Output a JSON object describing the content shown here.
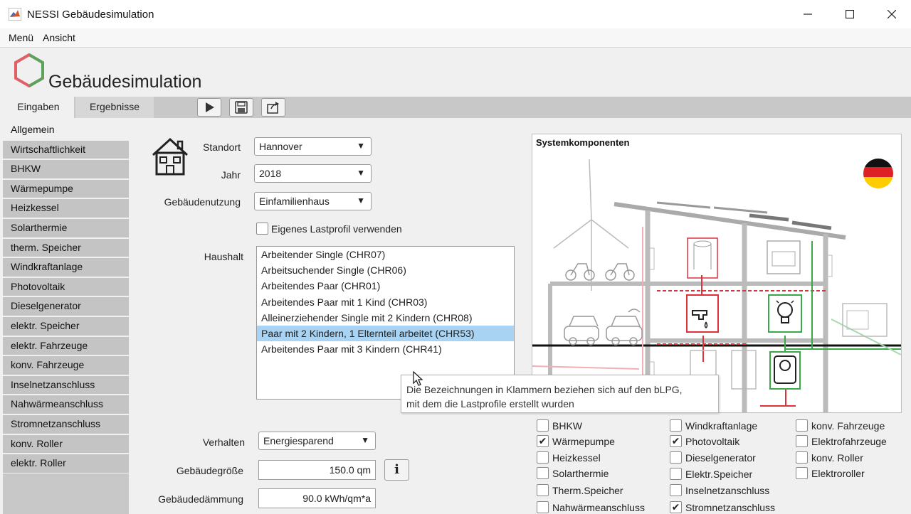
{
  "window": {
    "title": "NESSI Gebäudesimulation"
  },
  "menu": {
    "items": [
      "Menü",
      "Ansicht"
    ]
  },
  "header": {
    "title": "Gebäudesimulation"
  },
  "tabs": [
    {
      "label": "Eingaben",
      "active": true
    },
    {
      "label": "Ergebnisse",
      "active": false
    }
  ],
  "toolbar": {
    "icons": [
      "play-icon",
      "save-icon",
      "export-icon"
    ]
  },
  "sidebar": {
    "items": [
      "Allgemein",
      "Wirtschaftlichkeit",
      "BHKW",
      "Wärmepumpe",
      "Heizkessel",
      "Solarthermie",
      "therm. Speicher",
      "Windkraftanlage",
      "Photovoltaik",
      "Dieselgenerator",
      "elektr. Speicher",
      "elektr. Fahrzeuge",
      "konv. Fahrzeuge",
      "Inselnetzanschluss",
      "Nahwärmeanschluss",
      "Stromnetzanschluss",
      "konv. Roller",
      "elektr. Roller"
    ],
    "active_index": 0
  },
  "form": {
    "standort": {
      "label": "Standort",
      "value": "Hannover"
    },
    "jahr": {
      "label": "Jahr",
      "value": "2018"
    },
    "nutzung": {
      "label": "Gebäudenutzung",
      "value": "Einfamilienhaus"
    },
    "eigenes_lastprofil": {
      "label": "Eigenes Lastprofil verwenden",
      "checked": false
    },
    "haushalt": {
      "label": "Haushalt",
      "options": [
        "Arbeitender Single (CHR07)",
        "Arbeitsuchender Single (CHR06)",
        "Arbeitendes Paar (CHR01)",
        "Arbeitendes Paar mit 1 Kind (CHR03)",
        "Alleinerziehender Single mit 2 Kindern (CHR08)",
        "Paar mit 2 Kindern, 1 Elternteil arbeitet (CHR53)",
        "Arbeitendes Paar mit 3 Kindern (CHR41)"
      ],
      "selected_index": 5
    },
    "verhalten": {
      "label": "Verhalten",
      "value": "Energiesparend"
    },
    "groesse": {
      "label": "Gebäudegröße",
      "value": "150.0 qm"
    },
    "daemmung": {
      "label": "Gebäudedämmung",
      "value": "90.0 kWh/qm*a"
    },
    "info_label": "i"
  },
  "tooltip": {
    "line1": "Die Bezeichnungen in Klammern beziehen sich auf den bLPG,",
    "line2": "mit dem die Lastprofile erstellt wurden"
  },
  "system": {
    "title": "Systemkomponenten",
    "components": [
      {
        "label": "BHKW",
        "checked": false
      },
      {
        "label": "Wärmepumpe",
        "checked": true
      },
      {
        "label": "Heizkessel",
        "checked": false
      },
      {
        "label": "Solarthermie",
        "checked": false
      },
      {
        "label": "Therm.Speicher",
        "checked": false
      },
      {
        "label": "Nahwärmeanschluss",
        "checked": false
      },
      {
        "label": "Windkraftanlage",
        "checked": false
      },
      {
        "label": "Photovoltaik",
        "checked": true
      },
      {
        "label": "Dieselgenerator",
        "checked": false
      },
      {
        "label": "Elektr.Speicher",
        "checked": false
      },
      {
        "label": "Inselnetzanschluss",
        "checked": false
      },
      {
        "label": "Stromnetzanschluss",
        "checked": true
      },
      {
        "label": "konv. Fahrzeuge",
        "checked": false
      },
      {
        "label": "Elektrofahrzeuge",
        "checked": false
      },
      {
        "label": "konv. Roller",
        "checked": false
      },
      {
        "label": "Elektroroller",
        "checked": false
      }
    ]
  },
  "colors": {
    "heat": "#e0303c",
    "electric": "#3aa84a",
    "selection": "#a9d3f2"
  }
}
